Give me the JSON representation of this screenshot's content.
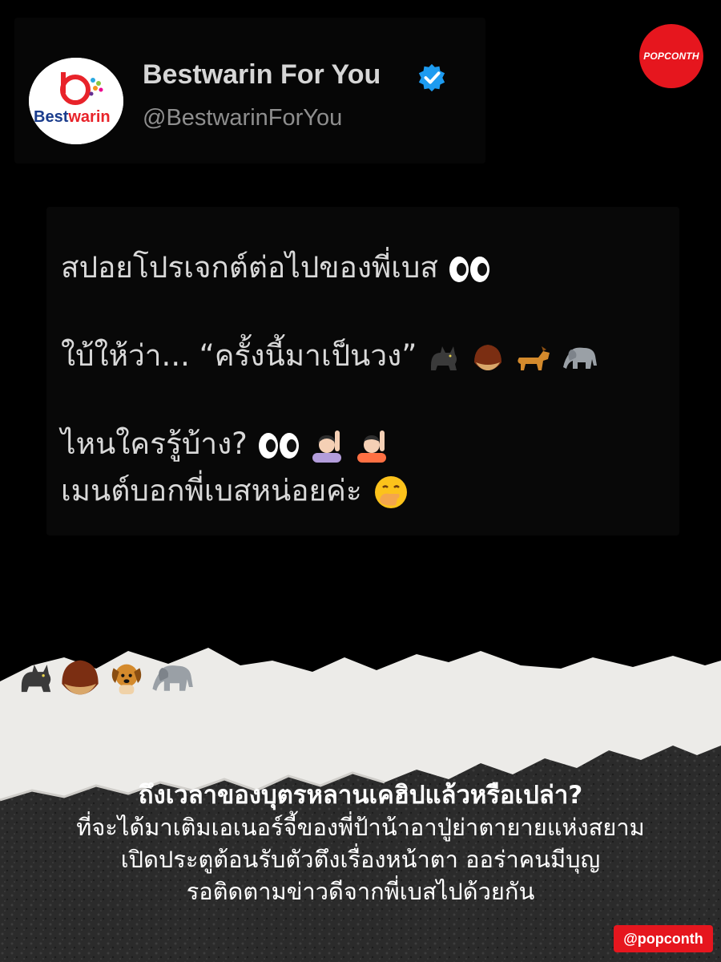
{
  "profile": {
    "display_name": "Bestwarin For You",
    "handle": "@BestwarinForYou",
    "avatar_text": "Bestwarin",
    "verified": true
  },
  "brand": {
    "badge_text": "POPCONTH",
    "corner_handle": "@popconth",
    "accent_color": "#e6161e"
  },
  "tweet": {
    "line1": "สปอยโปรเจกต์ต่อไปของพี่เบส",
    "line2": "ใบ้ให้ว่า... “ครั้งนี้มาเป็นวง”",
    "line3": "ไหนใครรู้บ้าง?",
    "line4": "เมนต์บอกพี่เบสหน่อยค่ะ"
  },
  "caption": {
    "headline": "ถึงเวลาของบุตรหลานเคฮิปแล้วหรือเปล่า?",
    "line1": "ที่จะได้มาเติมเอเนอร์จี้ของพี่ป้าน้าอาปู่ย่าตายายแห่งสยาม",
    "line2": "เปิดประตูต้อนรับตัวตึงเรื่องหน้าตา ออร่าคนมีบุญ",
    "line3": "รอติดตามข่าวดีจากพี่เบสไปด้วยกัน"
  },
  "icons": {
    "verified": "verified-badge-icon",
    "eyes": "eyes-icon",
    "cat": "black-cat-icon",
    "chestnut": "chestnut-icon",
    "dog": "dog-icon",
    "elephant": "elephant-icon",
    "raising_hand_woman": "raising-hand-woman-icon",
    "raising_hand_person": "raising-hand-person-icon",
    "hand_over_mouth": "face-with-hand-over-mouth-icon"
  }
}
